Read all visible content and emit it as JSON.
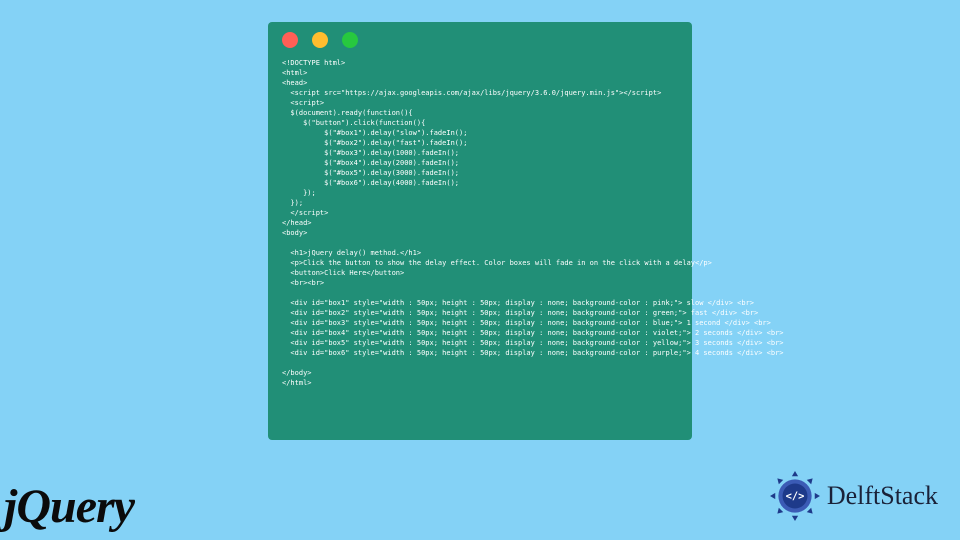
{
  "code_window": {
    "dot_colors": {
      "red": "#ff5f56",
      "yellow": "#ffbd2e",
      "green": "#27c93f"
    },
    "lines": [
      "<!DOCTYPE html>",
      "<html>",
      "<head>",
      "  <script src=\"https://ajax.googleapis.com/ajax/libs/jquery/3.6.0/jquery.min.js\"></script>",
      "  <script>",
      "  $(document).ready(function(){",
      "     $(\"button\").click(function(){",
      "          $(\"#box1\").delay(\"slow\").fadeIn();",
      "          $(\"#box2\").delay(\"fast\").fadeIn();",
      "          $(\"#box3\").delay(1000).fadeIn();",
      "          $(\"#box4\").delay(2000).fadeIn();",
      "          $(\"#box5\").delay(3000).fadeIn();",
      "          $(\"#box6\").delay(4000).fadeIn();",
      "     });",
      "  });",
      "  </script>",
      "</head>",
      "<body>",
      "",
      "  <h1>jQuery delay() method.</h1>",
      "  <p>Click the button to show the delay effect. Color boxes will fade in on the click with a delay</p>",
      "  <button>Click Here</button>",
      "  <br><br>",
      "",
      "  <div id=\"box1\" style=\"width : 50px; height : 50px; display : none; background-color : pink;\"> slow </div> <br>",
      "  <div id=\"box2\" style=\"width : 50px; height : 50px; display : none; background-color : green;\"> fast </div> <br>",
      "  <div id=\"box3\" style=\"width : 50px; height : 50px; display : none; background-color : blue;\"> 1 second </div> <br>",
      "  <div id=\"box4\" style=\"width : 50px; height : 50px; display : none; background-color : violet;\"> 2 seconds </div> <br>",
      "  <div id=\"box5\" style=\"width : 50px; height : 50px; display : none; background-color : yellow;\"> 3 seconds </div> <br>",
      "  <div id=\"box6\" style=\"width : 50px; height : 50px; display : none; background-color : purple;\"> 4 seconds </div> <br>",
      "",
      "</body>",
      "</html>"
    ]
  },
  "footer": {
    "jquery_logo_text": "jQuery",
    "delftstack_text": "DelftStack"
  }
}
